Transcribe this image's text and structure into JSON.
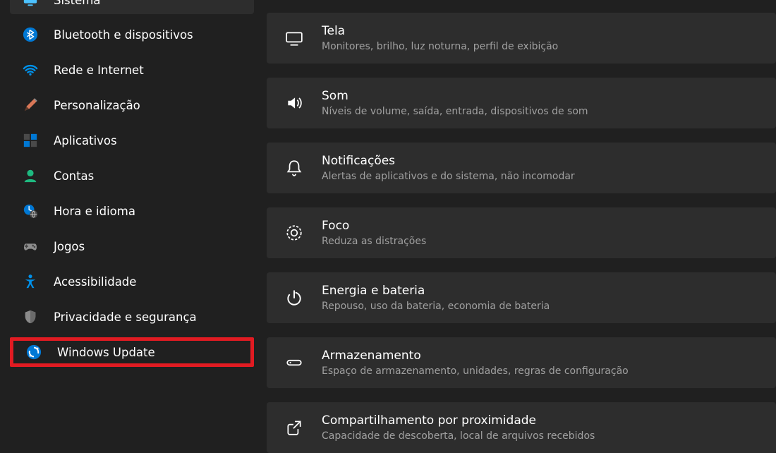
{
  "sidebar": {
    "items": [
      {
        "label": "Sistema",
        "icon": "monitor-icon",
        "selected": true,
        "highlight": false
      },
      {
        "label": "Bluetooth e dispositivos",
        "icon": "bluetooth-icon",
        "selected": false,
        "highlight": false
      },
      {
        "label": "Rede e Internet",
        "icon": "wifi-icon",
        "selected": false,
        "highlight": false
      },
      {
        "label": "Personalização",
        "icon": "paintbrush-icon",
        "selected": false,
        "highlight": false
      },
      {
        "label": "Aplicativos",
        "icon": "apps-icon",
        "selected": false,
        "highlight": false
      },
      {
        "label": "Contas",
        "icon": "person-icon",
        "selected": false,
        "highlight": false
      },
      {
        "label": "Hora e idioma",
        "icon": "time-language-icon",
        "selected": false,
        "highlight": false
      },
      {
        "label": "Jogos",
        "icon": "gamepad-icon",
        "selected": false,
        "highlight": false
      },
      {
        "label": "Acessibilidade",
        "icon": "accessibility-icon",
        "selected": false,
        "highlight": false
      },
      {
        "label": "Privacidade e segurança",
        "icon": "shield-icon",
        "selected": false,
        "highlight": false
      },
      {
        "label": "Windows Update",
        "icon": "update-icon",
        "selected": false,
        "highlight": true
      }
    ]
  },
  "main": {
    "cards": [
      {
        "icon": "display-icon",
        "title": "Tela",
        "sub": "Monitores, brilho, luz noturna, perfil de exibição"
      },
      {
        "icon": "sound-icon",
        "title": "Som",
        "sub": "Níveis de volume, saída, entrada, dispositivos de som"
      },
      {
        "icon": "bell-icon",
        "title": "Notificações",
        "sub": "Alertas de aplicativos e do sistema, não incomodar"
      },
      {
        "icon": "focus-icon",
        "title": "Foco",
        "sub": "Reduza as distrações"
      },
      {
        "icon": "power-icon",
        "title": "Energia e bateria",
        "sub": "Repouso, uso da bateria, economia de bateria"
      },
      {
        "icon": "storage-icon",
        "title": "Armazenamento",
        "sub": "Espaço de armazenamento, unidades, regras de configuração"
      },
      {
        "icon": "share-icon",
        "title": "Compartilhamento por proximidade",
        "sub": "Capacidade de descoberta, local de arquivos recebidos"
      }
    ]
  },
  "colors": {
    "accent_blue": "#0078d4",
    "highlight_red": "#e11b22",
    "card_bg": "#2d2d2d",
    "page_bg": "#202020"
  }
}
